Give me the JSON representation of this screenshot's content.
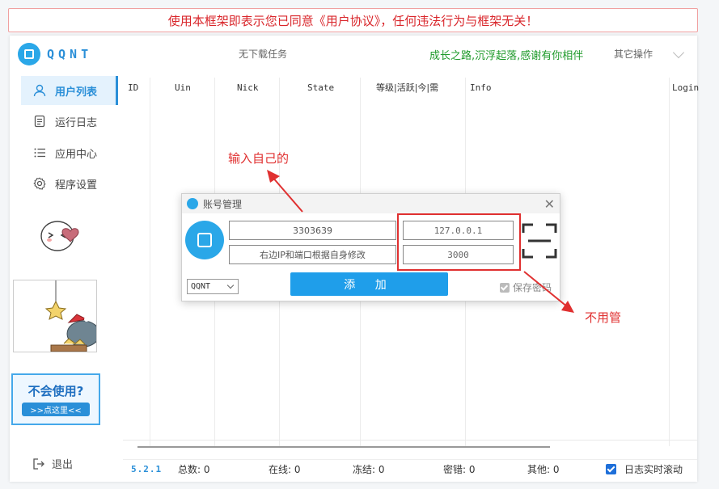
{
  "banner": {
    "text": "使用本框架即表示您已同意《用户协议》，任何违法行为与框架无关！"
  },
  "header": {
    "logo_text": "QQNT",
    "task_status": "无下载任务",
    "slogan": "成长之路,沉浮起落,感谢有你相伴",
    "other_ops": "其它操作"
  },
  "sidebar": {
    "items": [
      {
        "label": "用户列表",
        "icon": "user-icon",
        "active": true
      },
      {
        "label": "运行日志",
        "icon": "document-icon",
        "active": false
      },
      {
        "label": "应用中心",
        "icon": "list-icon",
        "active": false
      },
      {
        "label": "程序设置",
        "icon": "gear-icon",
        "active": false
      }
    ],
    "help": {
      "title": "不会使用?",
      "link": ">>点这里<<"
    },
    "logout": "退出"
  },
  "table": {
    "columns": [
      "ID",
      "Uin",
      "Nick",
      "State",
      "等级|活跃|今|需",
      "Info",
      "Login"
    ],
    "rows": []
  },
  "statusbar": {
    "version": "5.2.1",
    "total": "总数: 0",
    "online": "在线: 0",
    "frozen": "冻结: 0",
    "pwd_error": "密错: 0",
    "other": "其他: 0",
    "log_scroll": "日志实时滚动"
  },
  "dialog": {
    "title": "账号管理",
    "account": "3303639",
    "hint": "右边IP和端口根据自身修改",
    "ip": "127.0.0.1",
    "port": "3000",
    "protocol": "QQNT",
    "add_button": "添 加",
    "save_password": "保存密码"
  },
  "annotations": {
    "top": "输入自己的",
    "bottom": "不用管"
  },
  "colors": {
    "accent": "#2a8fd8",
    "warning": "#d9262b",
    "slogan": "#1e9a2a",
    "annotation": "#e03030"
  }
}
